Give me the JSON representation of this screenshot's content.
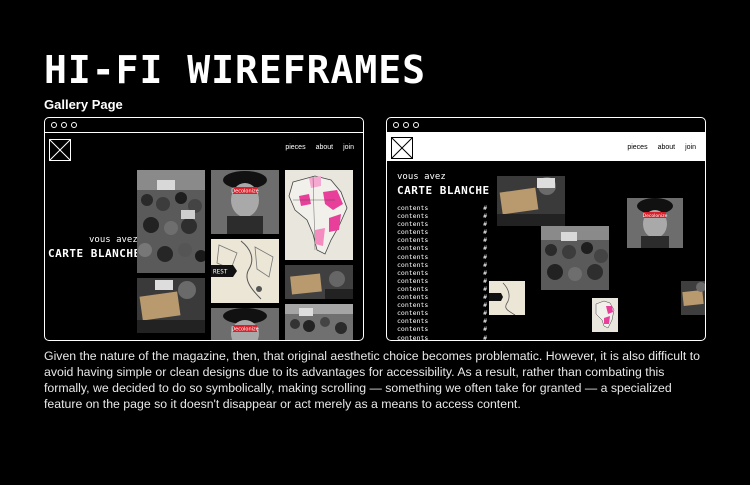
{
  "heading": "HI-FI WIREFRAMES",
  "subheading": "Gallery Page",
  "left_frame": {
    "nav": [
      "pieces",
      "about",
      "join"
    ],
    "vous_avez": "vous avez",
    "carte_blanche": "CARTE BLANCHE",
    "tile_texts": {
      "decolonize": "Decolonize",
      "rest": "REST"
    }
  },
  "right_frame": {
    "nav": [
      "pieces",
      "about",
      "join"
    ],
    "vous_avez": "vous avez",
    "carte_blanche": "CARTE BLANCHE",
    "contents_label": "contents",
    "hash_label": "#",
    "contents_count": 17,
    "tile_texts": {
      "decolonize": "Decolonize"
    }
  },
  "paragraph": "Given the nature of the magazine, then, that original aesthetic choice becomes problematic. However, it is also difficult to avoid having simple or clean designs due to its advantages for accessibility. As a result, rather than combating this formally, we decided to do so symbolically, making scrolling — something we often take for granted — a specialized feature on the page so it doesn't disappear or act merely as a means to access content.",
  "colors": {
    "background": "#000000",
    "accent_pink": "#e8409a",
    "accent_red": "#d8202a"
  }
}
